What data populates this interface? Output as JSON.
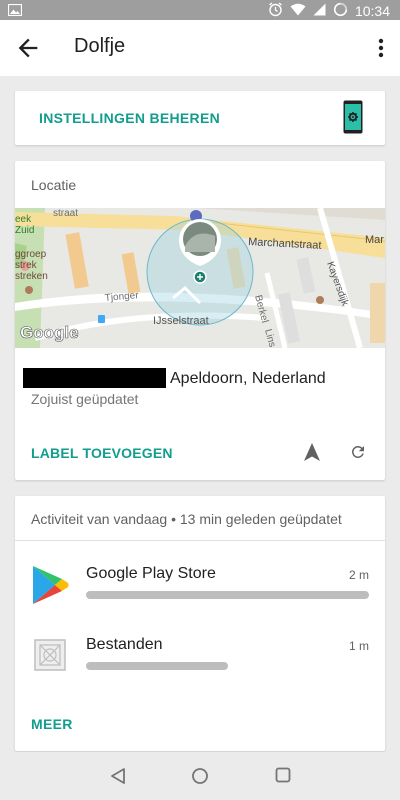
{
  "status_bar": {
    "time": "10:34",
    "icons": [
      "image-icon",
      "alarm-icon",
      "wifi-icon",
      "signal-icon",
      "battery-icon"
    ]
  },
  "app_bar": {
    "title": "Dolfje",
    "back_icon": "arrow-back-icon",
    "menu_icon": "more-vert-icon"
  },
  "manage_card": {
    "label": "INSTELLINGEN BEHEREN",
    "icon": "phone-settings-icon",
    "accent": "#129d8e"
  },
  "location_card": {
    "header": "Locatie",
    "map": {
      "labels": {
        "street_top": "straat",
        "street_main": "Marchantstraat",
        "street_main_right": "Mar",
        "park_1": "eek",
        "park_2": "Zuid",
        "group_1": "ggroep",
        "group_2": "strek",
        "group_3": "streken",
        "tjonger": "Tjonger",
        "ijssel": "IJsselstraat",
        "kayersdijk": "Kayersdijk",
        "berkel": "Berkel",
        "lin": "Lins",
        "google": "Google"
      }
    },
    "address": "Apeldoorn, Nederland",
    "updated": "Zojuist geüpdatet",
    "label_button": "LABEL TOEVOEGEN",
    "navigate_icon": "navigation-icon",
    "refresh_icon": "refresh-icon"
  },
  "activity_card": {
    "header": "Activiteit van vandaag • 13 min geleden geüpdatet",
    "apps": [
      {
        "name": "Google Play Store",
        "time": "2 m",
        "icon": "play-store-icon",
        "usage_fraction": 1.0
      },
      {
        "name": "Bestanden",
        "time": "1 m",
        "icon": "files-placeholder-icon",
        "usage_fraction": 0.5
      }
    ],
    "more_button": "MEER"
  },
  "nav_bar": {
    "back": "nav-back-icon",
    "home": "nav-home-icon",
    "recents": "nav-recents-icon"
  }
}
